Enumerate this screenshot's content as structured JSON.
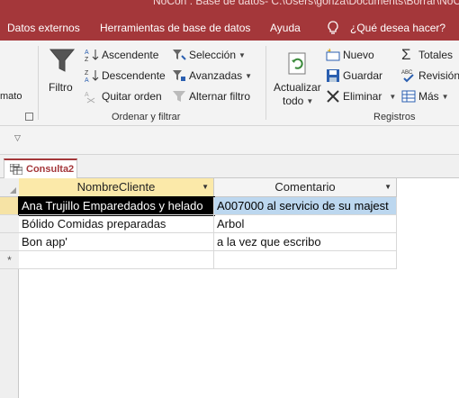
{
  "title_fragment": "NoCon : Base de datos- C:\\Users\\gonza\\Documents\\Borrar\\NoCon",
  "ribbon_tabs": [
    "Datos externos",
    "Herramientas de base de datos",
    "Ayuda",
    "¿Qué desea hacer?"
  ],
  "ribbon": {
    "cut_label": "mato",
    "filter_label": "Filtro",
    "ascending_label": "Ascendente",
    "descending_label": "Descendente",
    "remove_sort_label": "Quitar orden",
    "selection_label": "Selección",
    "advanced_label": "Avanzadas",
    "toggle_filter_label": "Alternar filtro",
    "group_sort_filter": "Ordenar y filtrar",
    "refresh_label_1": "Actualizar",
    "refresh_label_2": "todo",
    "new_label": "Nuevo",
    "save_label": "Guardar",
    "delete_label": "Eliminar",
    "totals_label": "Totales",
    "spelling_label": "Revisión",
    "more_label": "Más",
    "group_records": "Registros"
  },
  "document_tab": "Consulta2",
  "columns": [
    "NombreCliente",
    "Comentario"
  ],
  "rows": [
    [
      "Ana Trujillo Emparedados y helado",
      "A007000 al servicio de su majest"
    ],
    [
      "Bólido Comidas preparadas",
      "Arbol"
    ],
    [
      "Bon app'",
      "a la vez que escribo"
    ]
  ],
  "new_record_marker": "*",
  "colors": {
    "accent": "#a4373a",
    "header_selected": "#fbe9a9",
    "cell_selected": "#bcd7ef"
  }
}
